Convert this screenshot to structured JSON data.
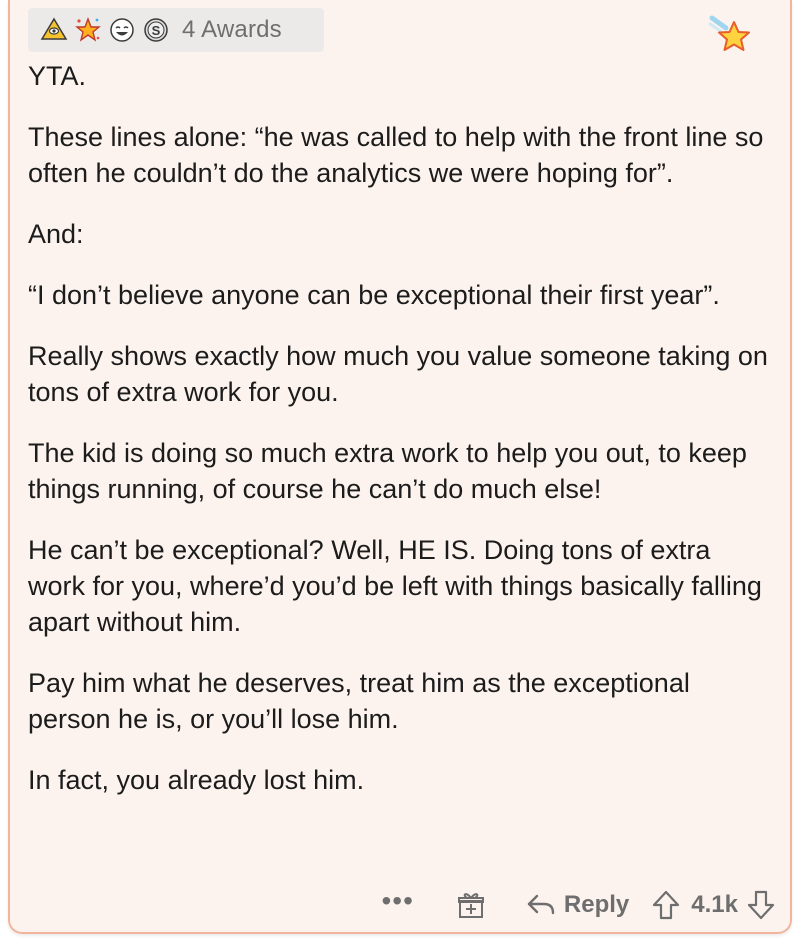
{
  "awards": {
    "icons": [
      "pyramid-award-icon",
      "star-burst-award-icon",
      "laughing-face-award-icon",
      "silver-coin-award-icon"
    ],
    "count_label": "4 Awards"
  },
  "badge": {
    "icon": "star-badge-icon",
    "color": "#f5a623"
  },
  "comment": {
    "paragraphs": [
      "YTA.",
      "These lines alone: “he was called to help with the front line so often he couldn’t do the analytics we were hoping for”.",
      "And:",
      "“I don’t believe anyone can be exceptional their first year”.",
      "Really shows exactly how much you value someone taking on tons of extra work for you.",
      "The kid is doing so much extra work to help you out, to keep things running, of course he can’t do much else!",
      "He can’t be exceptional? Well, HE IS. Doing tons of extra work for you, where’d you’d be left with things basically falling apart without him.",
      "Pay him what he deserves, treat him as the exceptional person he is, or you’ll lose him.",
      "In fact, you already lost him."
    ]
  },
  "actions": {
    "more_label": "•••",
    "reply_label": "Reply",
    "score": "4.1k"
  },
  "colors": {
    "card_background": "#fdf3ee",
    "card_border": "#f2b59b",
    "text": "#1c1c1c",
    "muted": "#6e6e6e"
  }
}
